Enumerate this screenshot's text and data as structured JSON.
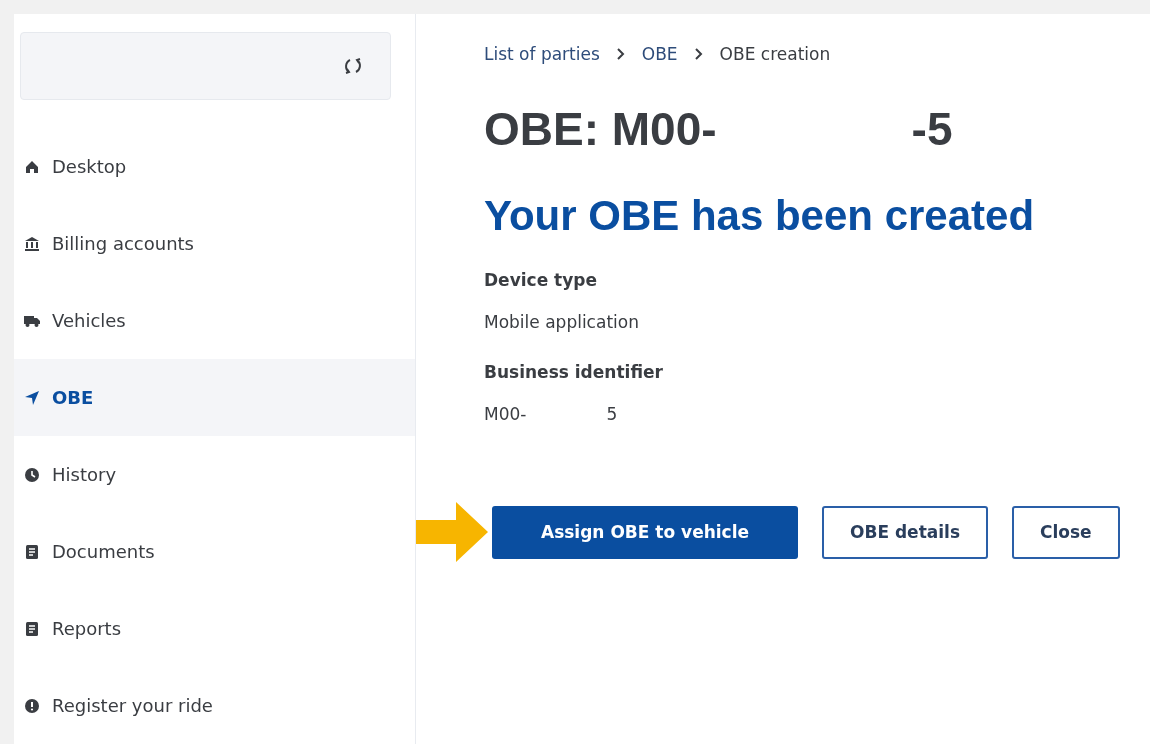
{
  "sidebar": {
    "items": [
      {
        "label": "Desktop",
        "selected": false
      },
      {
        "label": "Billing accounts",
        "selected": false
      },
      {
        "label": "Vehicles",
        "selected": false
      },
      {
        "label": "OBE",
        "selected": true
      },
      {
        "label": "History",
        "selected": false
      },
      {
        "label": "Documents",
        "selected": false
      },
      {
        "label": "Reports",
        "selected": false
      },
      {
        "label": "Register your ride",
        "selected": false
      }
    ]
  },
  "breadcrumb": [
    "List of parties",
    "OBE",
    "OBE creation"
  ],
  "title": {
    "prefix": "OBE: M00-",
    "suffix": "-5"
  },
  "message": "Your OBE has been created",
  "fields": [
    {
      "label": "Device type",
      "values": [
        "Mobile application"
      ]
    },
    {
      "label": "Business identifier",
      "values": [
        "M00-",
        "5"
      ]
    }
  ],
  "buttons": [
    {
      "label": "Assign OBE to vehicle",
      "kind": "primary"
    },
    {
      "label": "OBE details",
      "kind": "outline"
    },
    {
      "label": "Close",
      "kind": "outline"
    }
  ]
}
